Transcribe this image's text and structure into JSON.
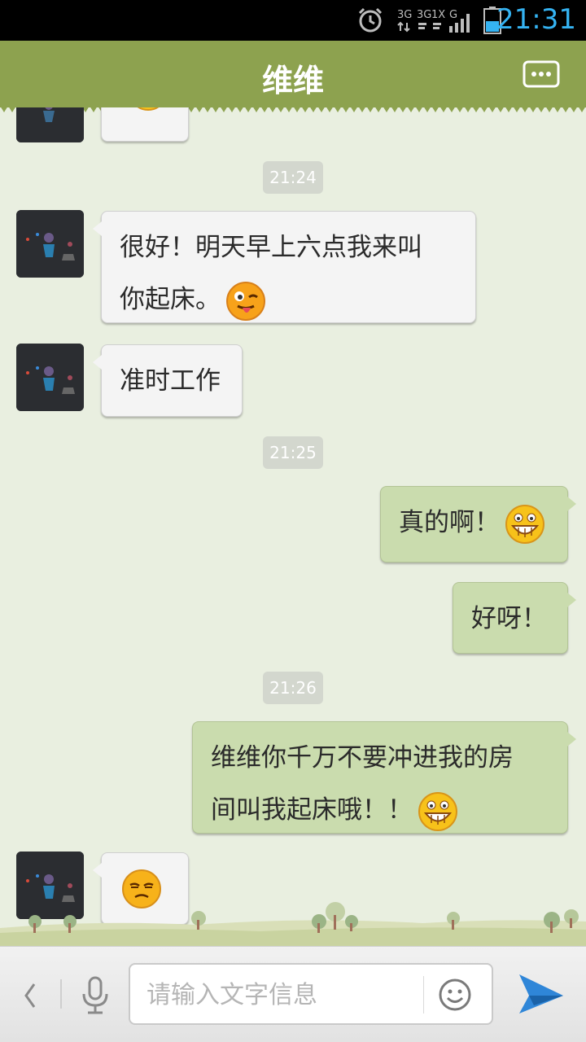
{
  "status_bar": {
    "network_text_1": "3G",
    "network_text_2": "3G",
    "network_text_3": "1X",
    "network_text_4": "G",
    "time": "21:31",
    "battery_level_fraction": 0.5,
    "alarm_icon": "alarm-clock-icon"
  },
  "header": {
    "title": "维维",
    "more_icon": "chat-more-icon"
  },
  "messages": [
    {
      "type": "timestamp",
      "text": "21:24"
    },
    {
      "type": "incoming",
      "text_line1": "很好！明天早上六点我来叫",
      "text_line2": "你起床。",
      "emoji": "wink-tongue-emoji"
    },
    {
      "type": "incoming",
      "text": "准时工作"
    },
    {
      "type": "timestamp",
      "text": "21:25"
    },
    {
      "type": "outgoing",
      "text": "真的啊！",
      "emoji": "grin-emoji"
    },
    {
      "type": "outgoing",
      "text": "好呀！"
    },
    {
      "type": "timestamp",
      "text": "21:26"
    },
    {
      "type": "outgoing",
      "text_line1": "维维你千万不要冲进我的房",
      "text_line2": "间叫我起床哦！！",
      "emoji": "grin-emoji"
    },
    {
      "type": "incoming",
      "emoji": "sleepy-emoji"
    }
  ],
  "input_bar": {
    "placeholder": "请输入文字信息",
    "back_icon": "chevron-left-icon",
    "mic_icon": "microphone-icon",
    "emoji_icon": "smiley-icon",
    "send_icon": "paper-plane-icon"
  },
  "colors": {
    "header_bg": "#8da24f",
    "chat_bg": "#e9efe0",
    "outgoing_bubble": "#cadcae",
    "incoming_bubble": "#f4f4f4",
    "clock_color": "#35b3f2"
  }
}
